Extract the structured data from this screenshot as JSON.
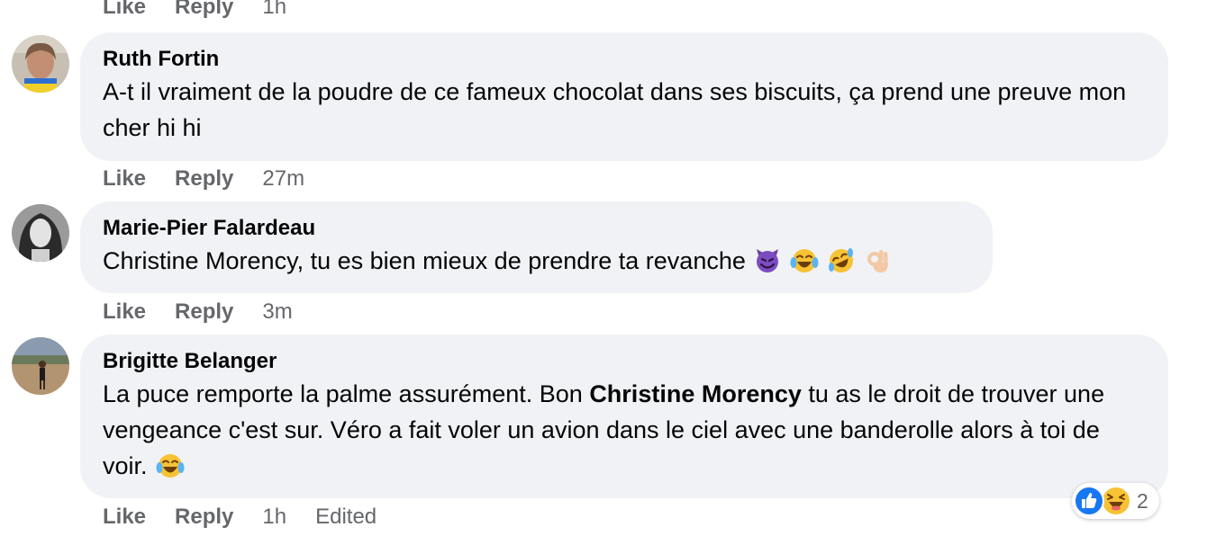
{
  "top_actions": {
    "like": "Like",
    "reply": "Reply",
    "time": "1h"
  },
  "comments": [
    {
      "author": "Ruth Fortin",
      "text": "A-t il vraiment de la poudre de ce fameux chocolat dans ses biscuits, ça prend une preuve mon cher hi hi",
      "like": "Like",
      "reply": "Reply",
      "time": "27m"
    },
    {
      "author": "Marie-Pier Falardeau",
      "text": "Christine Morency, tu es bien mieux de prendre ta revanche",
      "emojis": [
        "smiling-devil-icon",
        "tears-of-joy-icon",
        "rolling-laughing-icon",
        "ok-hand-icon"
      ],
      "like": "Like",
      "reply": "Reply",
      "time": "3m"
    },
    {
      "author": "Brigitte Belanger",
      "text_before": "La puce remporte la palme assurément. Bon",
      "mention": "Christine Morency",
      "text_after": "tu as le droit de trouver une vengeance c'est sur. Véro a fait voler un avion dans le ciel avec une banderolle alors à toi de voir.",
      "emojis": [
        "tears-of-joy-icon"
      ],
      "like": "Like",
      "reply": "Reply",
      "time": "1h",
      "edited": "Edited",
      "reactions": {
        "icons": [
          "like-reaction-icon",
          "haha-reaction-icon"
        ],
        "count": "2"
      }
    }
  ],
  "colors": {
    "bubble": "#f0f2f5",
    "muted": "#65676b",
    "text": "#050505",
    "like_blue": "#1877f2",
    "emoji_yellow": "#f7c234"
  }
}
